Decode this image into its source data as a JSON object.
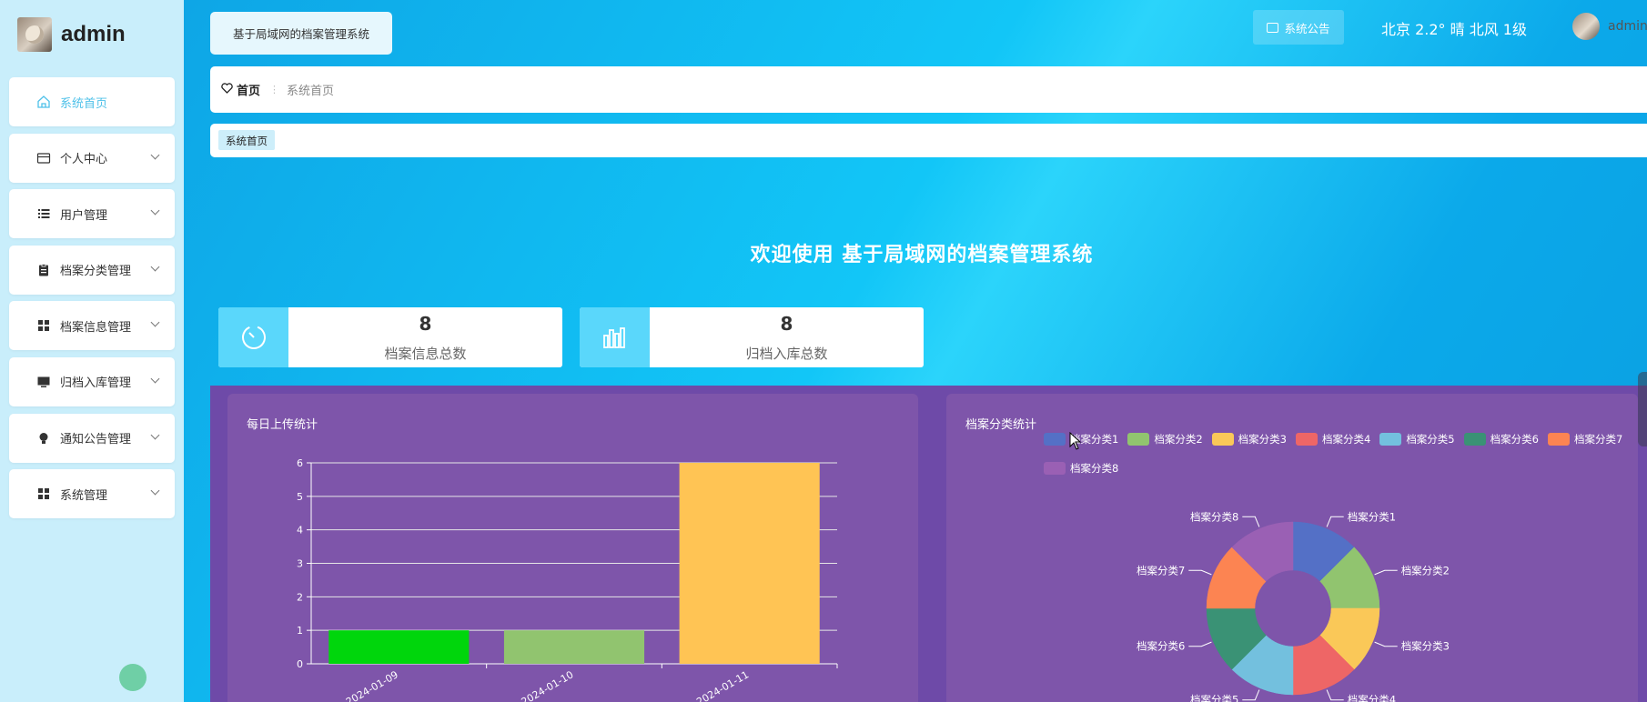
{
  "sidebar": {
    "username": "admin",
    "items": [
      {
        "label": "系统首页",
        "icon": "home-icon",
        "active": true
      },
      {
        "label": "个人中心",
        "icon": "card-icon"
      },
      {
        "label": "用户管理",
        "icon": "list-icon"
      },
      {
        "label": "档案分类管理",
        "icon": "clipboard-icon"
      },
      {
        "label": "档案信息管理",
        "icon": "grid-icon"
      },
      {
        "label": "归档入库管理",
        "icon": "monitor-icon"
      },
      {
        "label": "通知公告管理",
        "icon": "bulb-icon"
      },
      {
        "label": "系统管理",
        "icon": "grid-icon"
      }
    ]
  },
  "header": {
    "system_title": "基于局域网的档案管理系统",
    "notice_label": "系统公告",
    "weather": "北京  2.2°  晴  北风  1级",
    "user_label": "admin"
  },
  "breadcrumb": {
    "home": "首页",
    "current": "系统首页"
  },
  "tabs": [
    "系统首页"
  ],
  "welcome": "欢迎使用 基于局域网的档案管理系统",
  "stats": [
    {
      "value": "8",
      "label": "档案信息总数",
      "icon": "timer-icon"
    },
    {
      "value": "8",
      "label": "归档入库总数",
      "icon": "bar-chart-icon"
    }
  ],
  "colors": {
    "accent": "#4fc1e9",
    "panel": "#7e55aa",
    "stat_icon_bg": "#5ad7fb"
  },
  "chart_data": [
    {
      "type": "bar",
      "title": "每日上传统计",
      "categories": [
        "2024-01-09",
        "2024-01-10",
        "2024-01-11"
      ],
      "values": [
        1,
        1,
        6
      ],
      "colors": [
        "#00d60c",
        "#91c46f",
        "#ffc454"
      ],
      "ylim": [
        0,
        6
      ],
      "yticks": [
        0,
        1,
        2,
        3,
        4,
        5,
        6
      ],
      "xlabel": "",
      "ylabel": "",
      "grid": true
    },
    {
      "type": "pie",
      "title": "档案分类统计",
      "donut": true,
      "legend_position": "top",
      "labels": [
        "档案分类1",
        "档案分类2",
        "档案分类3",
        "档案分类4",
        "档案分类5",
        "档案分类6",
        "档案分类7",
        "档案分类8"
      ],
      "values": [
        1,
        1,
        1,
        1,
        1,
        1,
        1,
        1
      ],
      "colors": [
        "#5470c6",
        "#91c46f",
        "#fac858",
        "#ee6666",
        "#73c0de",
        "#3a9275",
        "#fc8452",
        "#9a60b4"
      ]
    }
  ]
}
